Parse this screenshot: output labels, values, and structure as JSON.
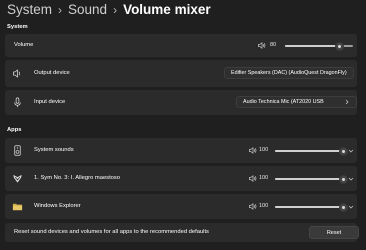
{
  "breadcrumb": {
    "items": [
      "System",
      "Sound",
      "Volume mixer"
    ],
    "separator": "›"
  },
  "system_section": {
    "header": "System",
    "volume": {
      "label": "Volume",
      "value": "80",
      "level": 0.8
    },
    "output_device": {
      "label": "Output device",
      "selected": "Edifier Speakers (DAC) (AudioQuest DragonFly)"
    },
    "input_device": {
      "label": "Input device",
      "selected": "Audio Technica Mic (AT2020 USB"
    }
  },
  "apps_section": {
    "header": "Apps",
    "apps": [
      {
        "name": "System sounds",
        "icon": "speaker-device-icon",
        "value": "100",
        "level": 1.0
      },
      {
        "name": "1. Sym No. 3: I. Allegro maestoso",
        "icon": "media-player-icon",
        "value": "100",
        "level": 1.0
      },
      {
        "name": "Windows Explorer",
        "icon": "folder-icon",
        "value": "100",
        "level": 1.0
      }
    ]
  },
  "reset": {
    "description": "Reset sound devices and volumes for all apps to the recommended defaults",
    "button_label": "Reset"
  },
  "colors": {
    "background": "#1f1f1f",
    "card": "#2b2b2b",
    "slider_fill": "#cfcfcf"
  }
}
